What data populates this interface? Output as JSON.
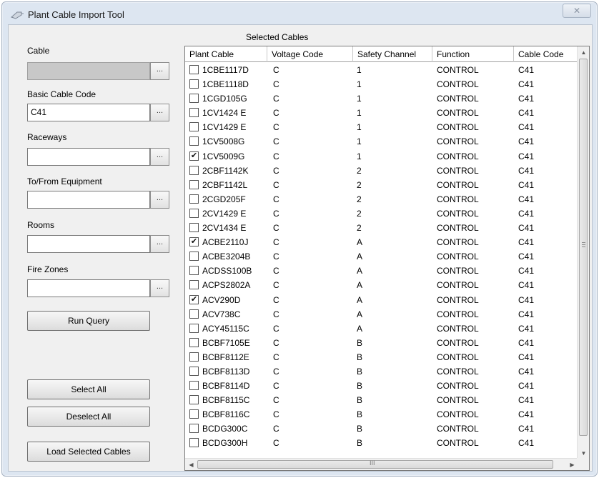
{
  "window": {
    "title": "Plant Cable Import Tool",
    "close_glyph": "✕"
  },
  "left": {
    "cable_label": "Cable",
    "cable_value": "",
    "basic_code_label": "Basic Cable Code",
    "basic_code_value": "C41",
    "raceways_label": "Raceways",
    "raceways_value": "",
    "equipment_label": "To/From Equipment",
    "equipment_value": "",
    "rooms_label": "Rooms",
    "rooms_value": "",
    "firezones_label": "Fire Zones",
    "firezones_value": "",
    "browse_label": "...",
    "run_query": "Run Query",
    "select_all": "Select All",
    "deselect_all": "Deselect All",
    "load_selected": "Load Selected Cables"
  },
  "grid": {
    "title": "Selected Cables",
    "columns": [
      "Plant Cable",
      "Voltage Code",
      "Safety Channel",
      "Function",
      "Cable Code"
    ],
    "rows": [
      {
        "checked": false,
        "cable": "1CBE1117D",
        "voltage": "C",
        "channel": "1",
        "function": "CONTROL",
        "code": "C41"
      },
      {
        "checked": false,
        "cable": "1CBE1118D",
        "voltage": "C",
        "channel": "1",
        "function": "CONTROL",
        "code": "C41"
      },
      {
        "checked": false,
        "cable": "1CGD105G",
        "voltage": "C",
        "channel": "1",
        "function": "CONTROL",
        "code": "C41"
      },
      {
        "checked": false,
        "cable": "1CV1424 E",
        "voltage": "C",
        "channel": "1",
        "function": "CONTROL",
        "code": "C41"
      },
      {
        "checked": false,
        "cable": "1CV1429 E",
        "voltage": "C",
        "channel": "1",
        "function": "CONTROL",
        "code": "C41"
      },
      {
        "checked": false,
        "cable": "1CV5008G",
        "voltage": "C",
        "channel": "1",
        "function": "CONTROL",
        "code": "C41"
      },
      {
        "checked": true,
        "cable": "1CV5009G",
        "voltage": "C",
        "channel": "1",
        "function": "CONTROL",
        "code": "C41"
      },
      {
        "checked": false,
        "cable": "2CBF1142K",
        "voltage": "C",
        "channel": "2",
        "function": "CONTROL",
        "code": "C41"
      },
      {
        "checked": false,
        "cable": "2CBF1142L",
        "voltage": "C",
        "channel": "2",
        "function": "CONTROL",
        "code": "C41"
      },
      {
        "checked": false,
        "cable": "2CGD205F",
        "voltage": "C",
        "channel": "2",
        "function": "CONTROL",
        "code": "C41"
      },
      {
        "checked": false,
        "cable": "2CV1429 E",
        "voltage": "C",
        "channel": "2",
        "function": "CONTROL",
        "code": "C41"
      },
      {
        "checked": false,
        "cable": "2CV1434 E",
        "voltage": "C",
        "channel": "2",
        "function": "CONTROL",
        "code": "C41"
      },
      {
        "checked": true,
        "cable": "ACBE2110J",
        "voltage": "C",
        "channel": "A",
        "function": "CONTROL",
        "code": "C41"
      },
      {
        "checked": false,
        "cable": "ACBE3204B",
        "voltage": "C",
        "channel": "A",
        "function": "CONTROL",
        "code": "C41"
      },
      {
        "checked": false,
        "cable": "ACDSS100B",
        "voltage": "C",
        "channel": "A",
        "function": "CONTROL",
        "code": "C41"
      },
      {
        "checked": false,
        "cable": "ACPS2802A",
        "voltage": "C",
        "channel": "A",
        "function": "CONTROL",
        "code": "C41"
      },
      {
        "checked": true,
        "cable": "ACV290D",
        "voltage": "C",
        "channel": "A",
        "function": "CONTROL",
        "code": "C41"
      },
      {
        "checked": false,
        "cable": "ACV738C",
        "voltage": "C",
        "channel": "A",
        "function": "CONTROL",
        "code": "C41"
      },
      {
        "checked": false,
        "cable": "ACY45115C",
        "voltage": "C",
        "channel": "A",
        "function": "CONTROL",
        "code": "C41"
      },
      {
        "checked": false,
        "cable": "BCBF7105E",
        "voltage": "C",
        "channel": "B",
        "function": "CONTROL",
        "code": "C41"
      },
      {
        "checked": false,
        "cable": "BCBF8112E",
        "voltage": "C",
        "channel": "B",
        "function": "CONTROL",
        "code": "C41"
      },
      {
        "checked": false,
        "cable": "BCBF8113D",
        "voltage": "C",
        "channel": "B",
        "function": "CONTROL",
        "code": "C41"
      },
      {
        "checked": false,
        "cable": "BCBF8114D",
        "voltage": "C",
        "channel": "B",
        "function": "CONTROL",
        "code": "C41"
      },
      {
        "checked": false,
        "cable": "BCBF8115C",
        "voltage": "C",
        "channel": "B",
        "function": "CONTROL",
        "code": "C41"
      },
      {
        "checked": false,
        "cable": "BCBF8116C",
        "voltage": "C",
        "channel": "B",
        "function": "CONTROL",
        "code": "C41"
      },
      {
        "checked": false,
        "cable": "BCDG300C",
        "voltage": "C",
        "channel": "B",
        "function": "CONTROL",
        "code": "C41"
      },
      {
        "checked": false,
        "cable": "BCDG300H",
        "voltage": "C",
        "channel": "B",
        "function": "CONTROL",
        "code": "C41"
      }
    ]
  },
  "scrollbar": {
    "up_glyph": "▲",
    "down_glyph": "▼",
    "left_glyph": "◀",
    "right_glyph": "▶",
    "grip_glyph": "III"
  },
  "icons": {
    "title_icon": "cable-plug-icon",
    "checkbox_glyph": "✔"
  }
}
